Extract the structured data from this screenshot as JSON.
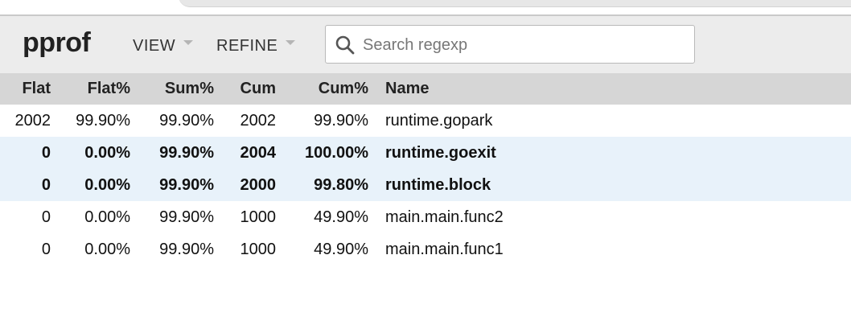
{
  "app": {
    "logo": "pprof"
  },
  "toolbar": {
    "view_label": "VIEW",
    "refine_label": "REFINE",
    "search_placeholder": "Search regexp",
    "search_value": ""
  },
  "table": {
    "columns": [
      "Flat",
      "Flat%",
      "Sum%",
      "Cum",
      "Cum%",
      "Name"
    ],
    "rows": [
      {
        "flat": "2002",
        "flat_pct": "99.90%",
        "sum_pct": "99.90%",
        "cum": "2002",
        "cum_pct": "99.90%",
        "name": "runtime.gopark",
        "highlighted": false
      },
      {
        "flat": "0",
        "flat_pct": "0.00%",
        "sum_pct": "99.90%",
        "cum": "2004",
        "cum_pct": "100.00%",
        "name": "runtime.goexit",
        "highlighted": true
      },
      {
        "flat": "0",
        "flat_pct": "0.00%",
        "sum_pct": "99.90%",
        "cum": "2000",
        "cum_pct": "99.80%",
        "name": "runtime.block",
        "highlighted": true
      },
      {
        "flat": "0",
        "flat_pct": "0.00%",
        "sum_pct": "99.90%",
        "cum": "1000",
        "cum_pct": "49.90%",
        "name": "main.main.func2",
        "highlighted": false
      },
      {
        "flat": "0",
        "flat_pct": "0.00%",
        "sum_pct": "99.90%",
        "cum": "1000",
        "cum_pct": "49.90%",
        "name": "main.main.func1",
        "highlighted": false
      }
    ]
  },
  "colors": {
    "toolbar_bg": "#ececec",
    "header_bg": "#d6d6d6",
    "highlight_bg": "#e8f2fa"
  }
}
